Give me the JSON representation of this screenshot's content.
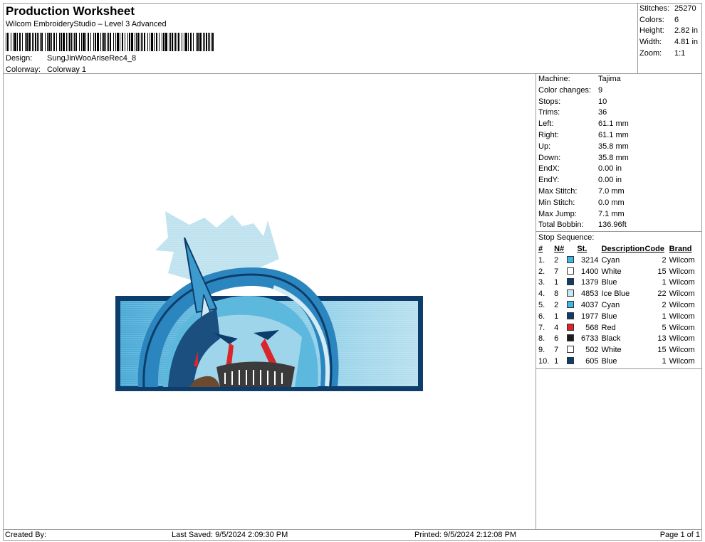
{
  "header": {
    "title": "Production Worksheet",
    "subtitle": "Wilcom EmbroideryStudio – Level 3 Advanced",
    "design_label": "Design:",
    "design_value": "SungJinWooAriseRec4_8",
    "colorway_label": "Colorway:",
    "colorway_value": "Colorway 1"
  },
  "stats": [
    {
      "label": "Stitches:",
      "value": "25270"
    },
    {
      "label": "Colors:",
      "value": "6"
    },
    {
      "label": "Height:",
      "value": "2.82 in"
    },
    {
      "label": "Width:",
      "value": "4.81 in"
    },
    {
      "label": "Zoom:",
      "value": "1:1"
    }
  ],
  "machine_props": [
    {
      "label": "Machine:",
      "value": "Tajima"
    },
    {
      "label": "Color changes:",
      "value": "9"
    },
    {
      "label": "Stops:",
      "value": "10"
    },
    {
      "label": "Trims:",
      "value": "36"
    },
    {
      "label": "Left:",
      "value": "61.1 mm"
    },
    {
      "label": "Right:",
      "value": "61.1 mm"
    },
    {
      "label": "Up:",
      "value": "35.8 mm"
    },
    {
      "label": "Down:",
      "value": "35.8 mm"
    },
    {
      "label": "EndX:",
      "value": "0.00 in"
    },
    {
      "label": "EndY:",
      "value": "0.00 in"
    },
    {
      "label": "Max Stitch:",
      "value": "7.0 mm"
    },
    {
      "label": "Min Stitch:",
      "value": "0.0 mm"
    },
    {
      "label": "Max Jump:",
      "value": "7.1 mm"
    },
    {
      "label": "Total Bobbin:",
      "value": "136.96ft"
    }
  ],
  "stop_sequence": {
    "title": "Stop Sequence:",
    "headers": {
      "idx": "#",
      "n": "N#",
      "st": "St.",
      "desc": "Description",
      "code": "Code",
      "brand": "Brand"
    },
    "rows": [
      {
        "idx": "1.",
        "n": "2",
        "color": "#3fb6e6",
        "st": "3214",
        "desc": "Cyan",
        "code": "2",
        "brand": "Wilcom"
      },
      {
        "idx": "2.",
        "n": "7",
        "color": "#ffffff",
        "st": "1400",
        "desc": "White",
        "code": "15",
        "brand": "Wilcom"
      },
      {
        "idx": "3.",
        "n": "1",
        "color": "#0d3d6b",
        "st": "1379",
        "desc": "Blue",
        "code": "1",
        "brand": "Wilcom"
      },
      {
        "idx": "4.",
        "n": "8",
        "color": "#c6e6f2",
        "st": "4853",
        "desc": "Ice Blue",
        "code": "22",
        "brand": "Wilcom"
      },
      {
        "idx": "5.",
        "n": "2",
        "color": "#3fb6e6",
        "st": "4037",
        "desc": "Cyan",
        "code": "2",
        "brand": "Wilcom"
      },
      {
        "idx": "6.",
        "n": "1",
        "color": "#0d3d6b",
        "st": "1977",
        "desc": "Blue",
        "code": "1",
        "brand": "Wilcom"
      },
      {
        "idx": "7.",
        "n": "4",
        "color": "#d8262b",
        "st": "568",
        "desc": "Red",
        "code": "5",
        "brand": "Wilcom"
      },
      {
        "idx": "8.",
        "n": "6",
        "color": "#1c1c1c",
        "st": "6733",
        "desc": "Black",
        "code": "13",
        "brand": "Wilcom"
      },
      {
        "idx": "9.",
        "n": "7",
        "color": "#ffffff",
        "st": "502",
        "desc": "White",
        "code": "15",
        "brand": "Wilcom"
      },
      {
        "idx": "10.",
        "n": "1",
        "color": "#0d3d6b",
        "st": "605",
        "desc": "Blue",
        "code": "1",
        "brand": "Wilcom"
      }
    ]
  },
  "footer": {
    "created_by": "Created By:",
    "last_saved": "Last Saved: 9/5/2024 2:09:30 PM",
    "printed": "Printed: 9/5/2024 2:12:08 PM",
    "page": "Page 1 of 1"
  }
}
